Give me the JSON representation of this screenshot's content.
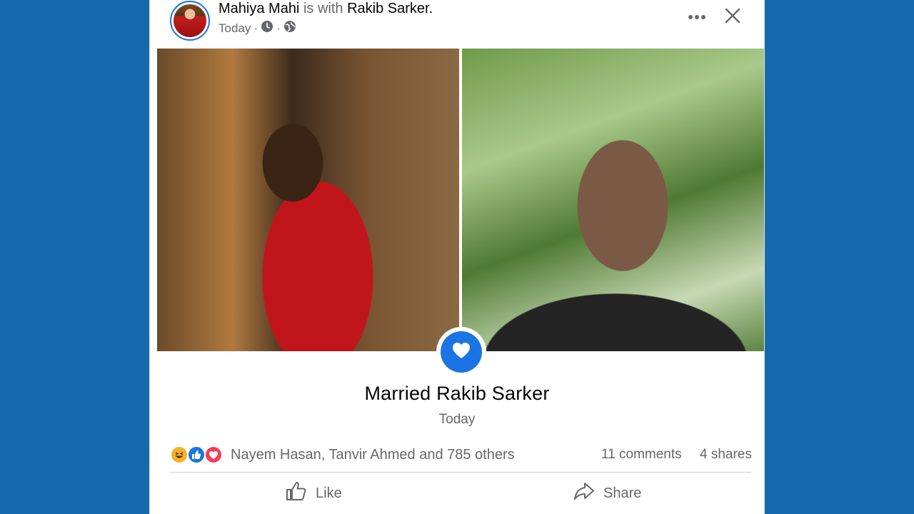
{
  "post": {
    "author": "Mahiya Mahi",
    "with_text": "is with",
    "tagged": "Rakib Sarker",
    "period": ".",
    "time": "Today",
    "separator": "·",
    "privacy_icon": "globe-icon"
  },
  "event": {
    "title": "Married Rakib Sarker",
    "date": "Today",
    "icon": "heart-icon"
  },
  "reactions": {
    "types": [
      "haha",
      "like",
      "love"
    ],
    "summary": "Nayem Hasan, Tanvir Ahmed and 785 others",
    "comments": "11 comments",
    "shares": "4 shares"
  },
  "actions": {
    "like_label": "Like",
    "share_label": "Share"
  },
  "colors": {
    "background": "#1769ad",
    "accent": "#1b74e4",
    "muted_text": "#65676b",
    "love": "#f33e58",
    "haha": "#f7b125"
  }
}
